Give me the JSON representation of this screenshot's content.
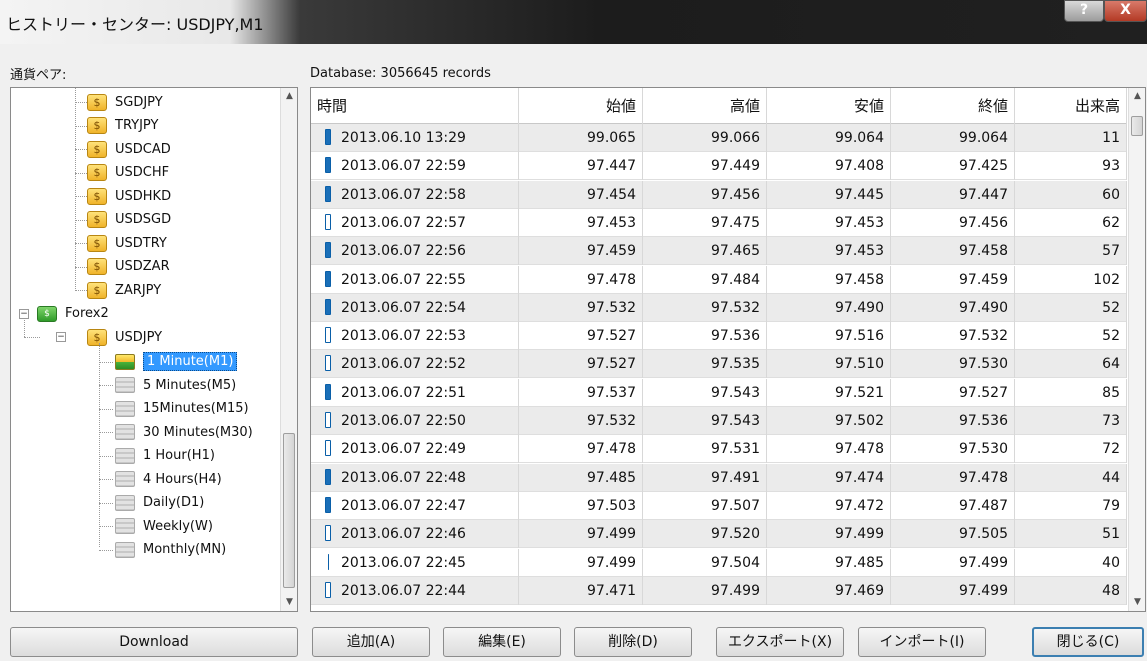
{
  "window": {
    "title": "ヒストリー・センター: USDJPY,M1",
    "help_label": "?",
    "close_label": "X"
  },
  "pairs_label": "通貨ペア:",
  "database_label": "Database: 3056645 records",
  "tree": {
    "symbols": [
      "SGDJPY",
      "TRYJPY",
      "USDCAD",
      "USDCHF",
      "USDHKD",
      "USDSGD",
      "USDTRY",
      "USDZAR",
      "ZARJPY"
    ],
    "coin_glyph": "$",
    "group": "Forex2",
    "symbol": "USDJPY",
    "timeframes": [
      "1 Minute(M1)",
      "5 Minutes(M5)",
      "15Minutes(M15)",
      "30 Minutes(M30)",
      "1 Hour(H1)",
      "4 Hours(H4)",
      "Daily(D1)",
      "Weekly(W)",
      "Monthly(MN)"
    ],
    "selected_timeframe": "1 Minute(M1)"
  },
  "grid": {
    "columns": [
      "時間",
      "始値",
      "高値",
      "安値",
      "終値",
      "出来高"
    ],
    "rows": [
      {
        "time": "2013.06.10 13:29",
        "open": "99.065",
        "high": "99.066",
        "low": "99.064",
        "close": "99.064",
        "volume": "11",
        "icon": "candle-down"
      },
      {
        "time": "2013.06.07 22:59",
        "open": "97.447",
        "high": "97.449",
        "low": "97.408",
        "close": "97.425",
        "volume": "93",
        "icon": "candle-down"
      },
      {
        "time": "2013.06.07 22:58",
        "open": "97.454",
        "high": "97.456",
        "low": "97.445",
        "close": "97.447",
        "volume": "60",
        "icon": "candle-down"
      },
      {
        "time": "2013.06.07 22:57",
        "open": "97.453",
        "high": "97.475",
        "low": "97.453",
        "close": "97.456",
        "volume": "62",
        "icon": "candle-up"
      },
      {
        "time": "2013.06.07 22:56",
        "open": "97.459",
        "high": "97.465",
        "low": "97.453",
        "close": "97.458",
        "volume": "57",
        "icon": "candle-down"
      },
      {
        "time": "2013.06.07 22:55",
        "open": "97.478",
        "high": "97.484",
        "low": "97.458",
        "close": "97.459",
        "volume": "102",
        "icon": "candle-down"
      },
      {
        "time": "2013.06.07 22:54",
        "open": "97.532",
        "high": "97.532",
        "low": "97.490",
        "close": "97.490",
        "volume": "52",
        "icon": "candle-down"
      },
      {
        "time": "2013.06.07 22:53",
        "open": "97.527",
        "high": "97.536",
        "low": "97.516",
        "close": "97.532",
        "volume": "52",
        "icon": "candle-up"
      },
      {
        "time": "2013.06.07 22:52",
        "open": "97.527",
        "high": "97.535",
        "low": "97.510",
        "close": "97.530",
        "volume": "64",
        "icon": "candle-up"
      },
      {
        "time": "2013.06.07 22:51",
        "open": "97.537",
        "high": "97.543",
        "low": "97.521",
        "close": "97.527",
        "volume": "85",
        "icon": "candle-down"
      },
      {
        "time": "2013.06.07 22:50",
        "open": "97.532",
        "high": "97.543",
        "low": "97.502",
        "close": "97.536",
        "volume": "73",
        "icon": "candle-up"
      },
      {
        "time": "2013.06.07 22:49",
        "open": "97.478",
        "high": "97.531",
        "low": "97.478",
        "close": "97.530",
        "volume": "72",
        "icon": "candle-up"
      },
      {
        "time": "2013.06.07 22:48",
        "open": "97.485",
        "high": "97.491",
        "low": "97.474",
        "close": "97.478",
        "volume": "44",
        "icon": "candle-down"
      },
      {
        "time": "2013.06.07 22:47",
        "open": "97.503",
        "high": "97.507",
        "low": "97.472",
        "close": "97.487",
        "volume": "79",
        "icon": "candle-down"
      },
      {
        "time": "2013.06.07 22:46",
        "open": "97.499",
        "high": "97.520",
        "low": "97.499",
        "close": "97.505",
        "volume": "51",
        "icon": "candle-up"
      },
      {
        "time": "2013.06.07 22:45",
        "open": "97.499",
        "high": "97.504",
        "low": "97.485",
        "close": "97.499",
        "volume": "40",
        "icon": "candle-doji"
      },
      {
        "time": "2013.06.07 22:44",
        "open": "97.471",
        "high": "97.499",
        "low": "97.469",
        "close": "97.499",
        "volume": "48",
        "icon": "candle-up"
      }
    ]
  },
  "buttons": {
    "download": "Download",
    "add": "追加(A)",
    "edit": "編集(E)",
    "delete": "削除(D)",
    "export": "エクスポート(X)",
    "import": "インポート(I)",
    "close": "閉じる(C)"
  },
  "colors": {
    "selection": "#3399ff",
    "candle": "#1a6fb8",
    "row_alt": "#ebebeb"
  }
}
